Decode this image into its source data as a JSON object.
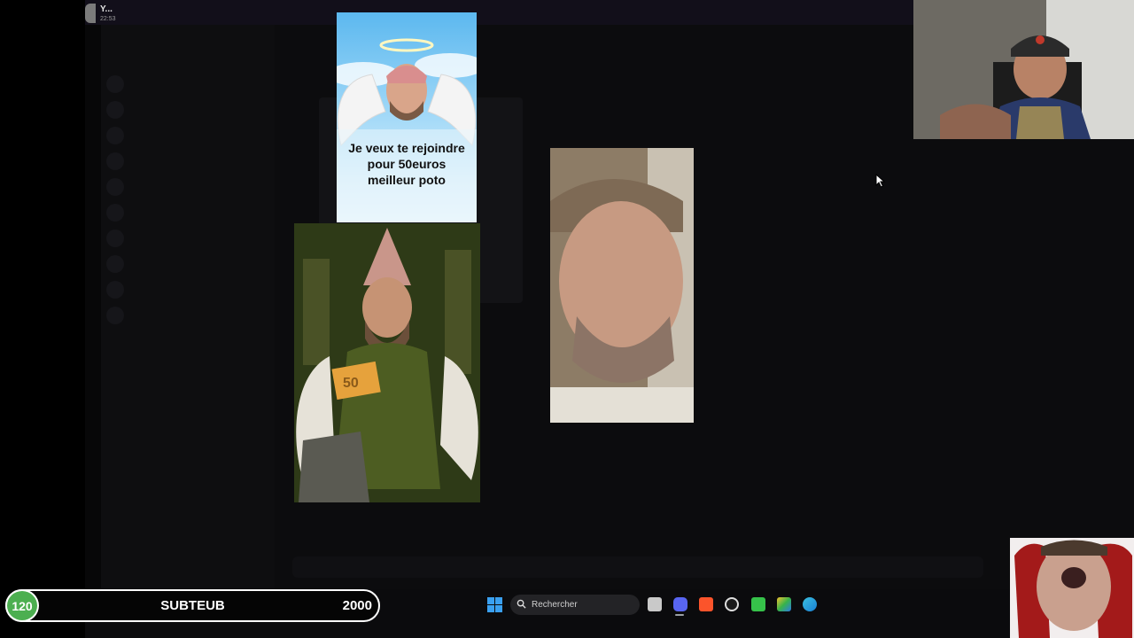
{
  "window": {
    "mini_title": "Y...",
    "mini_time": "22:53"
  },
  "meme": {
    "caption": "Je veux te rejoindre pour 50euros meilleur poto"
  },
  "sub_goal": {
    "current": "120",
    "label": "SUBTEUB",
    "target": "2000"
  },
  "taskbar": {
    "search_placeholder": "Rechercher",
    "icons": [
      "windows-start-icon",
      "search-icon",
      "file-explorer-icon",
      "discord-icon",
      "brave-icon",
      "obs-icon",
      "app-green-icon",
      "bluestacks-icon",
      "edge-icon"
    ]
  },
  "colors": {
    "sub_green": "#4caf50",
    "windows_blue": "#3aa0f0",
    "discord_blurple": "#5865f2",
    "brave_orange": "#fb542b"
  }
}
